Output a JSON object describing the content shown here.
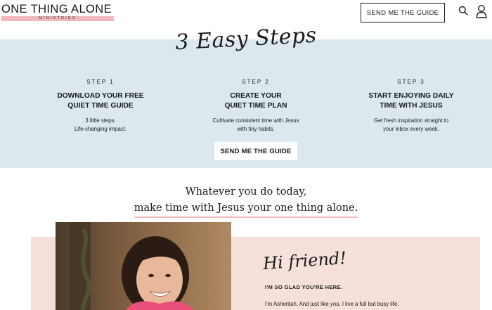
{
  "header": {
    "logo_main": "ONE THING ALONE",
    "logo_sub": "MINISTRIES",
    "cta_label": "SEND ME THE GUIDE",
    "search_icon": "search-icon",
    "user_icon": "user-icon"
  },
  "steps_section": {
    "title": "3 Easy Steps",
    "steps": [
      {
        "label": "STEP 1",
        "title_line1": "DOWNLOAD YOUR FREE",
        "title_line2": "QUIET TIME GUIDE",
        "desc_line1": "3 little steps.",
        "desc_line2": "Life-changing impact."
      },
      {
        "label": "STEP 2",
        "title_line1": "CREATE YOUR",
        "title_line2": "QUIET TIME PLAN",
        "desc_line1": "Cultivate consistent time with Jesus",
        "desc_line2": "with tiny habits."
      },
      {
        "label": "STEP 3",
        "title_line1": "START ENJOYING DAILY",
        "title_line2": "TIME WITH JESUS",
        "desc_line1": "Get fresh inspiration straight to",
        "desc_line2": "your inbox every week."
      }
    ],
    "cta_label": "SEND ME THE GUIDE"
  },
  "tagline": {
    "line1": "Whatever you do today,",
    "line2": "make time with Jesus your one thing alone."
  },
  "intro_section": {
    "greeting": "Hi friend!",
    "heading": "I'M SO GLAD YOU'RE HERE.",
    "body": "I'm Asheritah. And just like you, I live a full but busy life."
  },
  "colors": {
    "band_blue": "#dbe8ee",
    "accent_pink": "#f2b8bd",
    "panel_pink": "#f6e1da"
  }
}
